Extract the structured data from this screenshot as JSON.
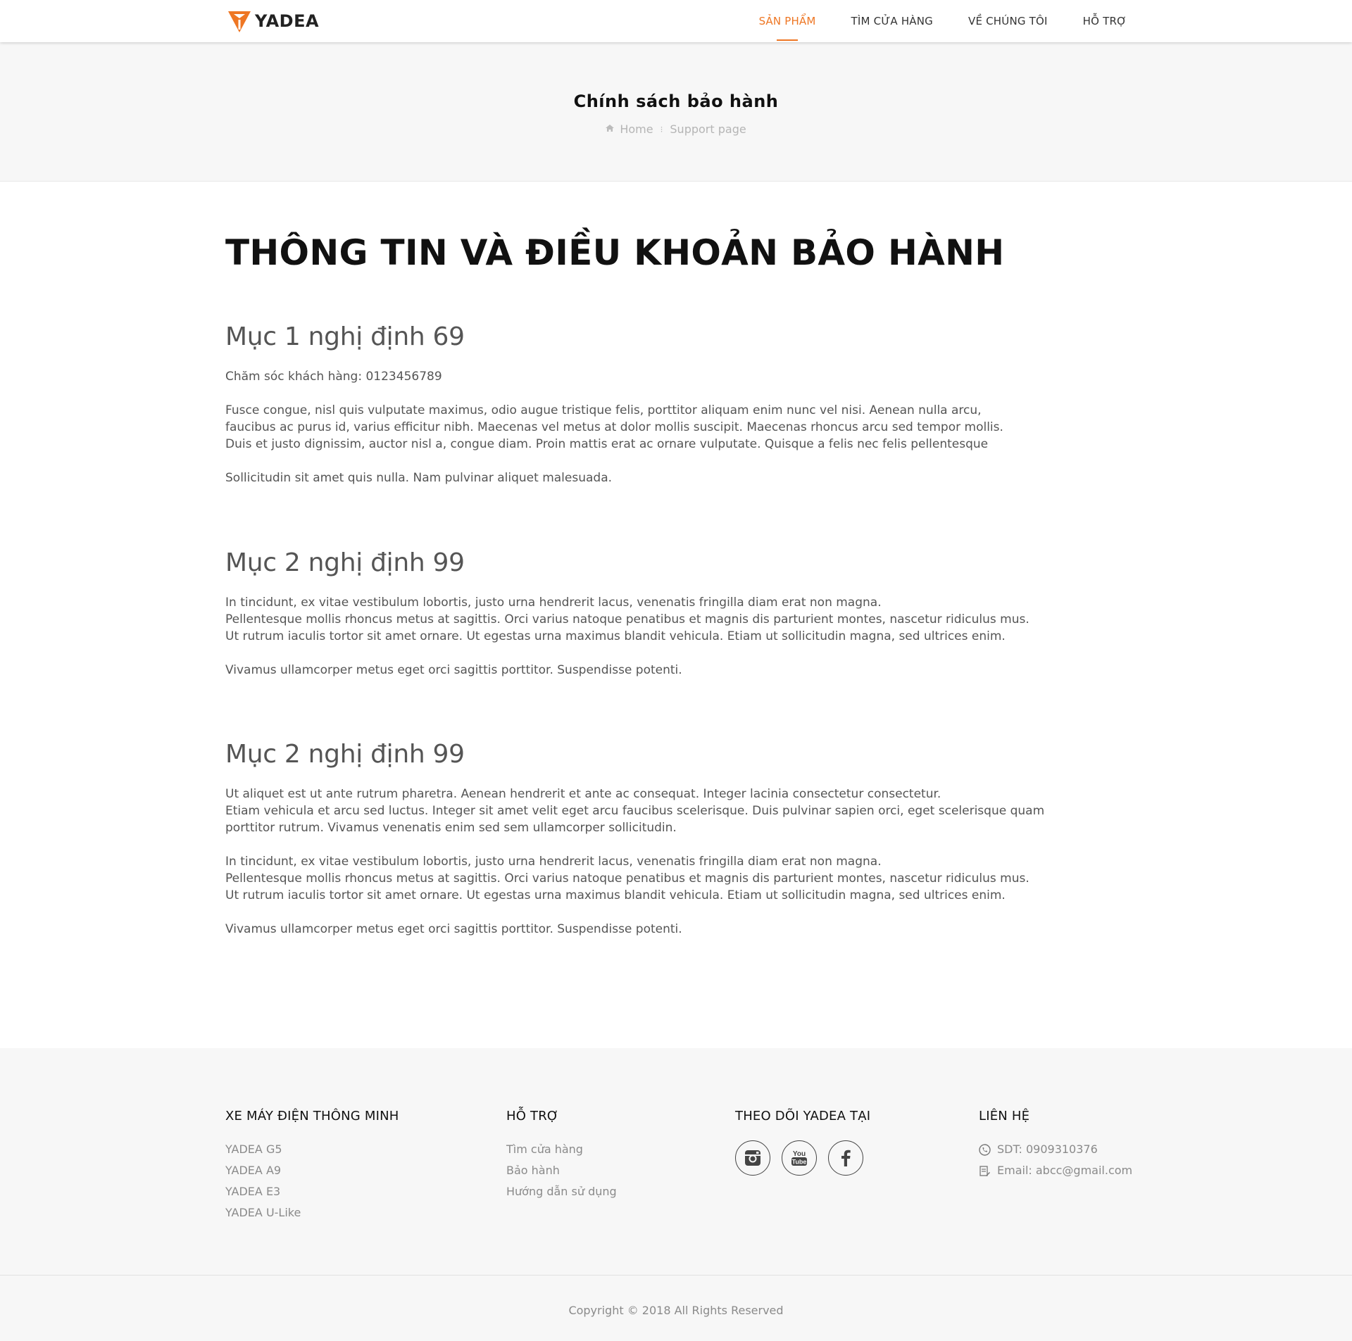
{
  "brand": {
    "name": "YADEA",
    "accent_color": "#ee7623"
  },
  "nav": {
    "items": [
      {
        "label": "SẢN PHẨM",
        "active": true
      },
      {
        "label": "TÌM CỬA HÀNG",
        "active": false
      },
      {
        "label": "VỀ CHÚNG TÔI",
        "active": false
      },
      {
        "label": "HỖ TRỢ",
        "active": false
      }
    ]
  },
  "banner": {
    "title": "Chính sách bảo hành",
    "breadcrumb": {
      "home": "Home",
      "current": "Support page",
      "home_icon": "home-icon"
    }
  },
  "main": {
    "heading": "THÔNG TIN VÀ ĐIỀU KHOẢN BẢO HÀNH",
    "sections": [
      {
        "title": "Mục 1 nghị định 69",
        "paragraphs": [
          "Chăm sóc khách hàng: 0123456789",
          "Fusce congue, nisl quis vulputate maximus, odio augue tristique felis, porttitor aliquam enim nunc vel nisi. Aenean nulla arcu,\nfaucibus ac purus id, varius efficitur nibh. Maecenas vel metus at dolor mollis suscipit. Maecenas rhoncus arcu sed tempor mollis.\nDuis et justo dignissim, auctor nisl a, congue diam. Proin mattis erat ac ornare vulputate. Quisque a felis nec felis pellentesque",
          "Sollicitudin sit amet quis nulla. Nam pulvinar aliquet malesuada."
        ]
      },
      {
        "title": "Mục 2 nghị định 99",
        "paragraphs": [
          "In tincidunt, ex vitae vestibulum lobortis, justo urna hendrerit lacus, venenatis fringilla diam erat non magna.\nPellentesque mollis rhoncus metus at sagittis. Orci varius natoque penatibus et magnis dis parturient montes, nascetur ridiculus mus.\nUt rutrum iaculis tortor sit amet ornare. Ut egestas urna maximus blandit vehicula. Etiam ut sollicitudin magna, sed ultrices enim.",
          "Vivamus ullamcorper metus eget orci sagittis porttitor. Suspendisse potenti."
        ]
      },
      {
        "title": "Mục 2 nghị định 99",
        "paragraphs": [
          "Ut aliquet est ut ante rutrum pharetra. Aenean hendrerit et ante ac consequat. Integer lacinia consectetur consectetur.\nEtiam vehicula et arcu sed luctus. Integer sit amet velit eget arcu faucibus scelerisque. Duis pulvinar sapien orci, eget scelerisque quam\nporttitor rutrum. Vivamus venenatis enim sed sem ullamcorper sollicitudin.",
          "In tincidunt, ex vitae vestibulum lobortis, justo urna hendrerit lacus, venenatis fringilla diam erat non magna.\nPellentesque mollis rhoncus metus at sagittis. Orci varius natoque penatibus et magnis dis parturient montes, nascetur ridiculus mus.\nUt rutrum iaculis tortor sit amet ornare. Ut egestas urna maximus blandit vehicula. Etiam ut sollicitudin magna, sed ultrices enim.",
          "Vivamus ullamcorper metus eget orci sagittis porttitor. Suspendisse potenti."
        ]
      }
    ]
  },
  "footer": {
    "products": {
      "title": "XE MÁY ĐIỆN THÔNG MINH",
      "items": [
        "YADEA G5",
        "YADEA A9",
        "YADEA E3",
        "YADEA U-Like"
      ]
    },
    "support": {
      "title": "HỖ TRỢ",
      "items": [
        "Tìm cửa hàng",
        "Bảo hành",
        "Hướng dẫn sử dụng"
      ]
    },
    "follow": {
      "title": "THEO DÕI YADEA TẠI",
      "icons": [
        "instagram-icon",
        "youtube-icon",
        "facebook-icon"
      ]
    },
    "contact": {
      "title": "LIÊN HỆ",
      "phone": "SDT: 0909310376",
      "email": "Email: abcc@gmail.com"
    },
    "copyright": "Copyright © 2018 All Rights Reserved"
  }
}
